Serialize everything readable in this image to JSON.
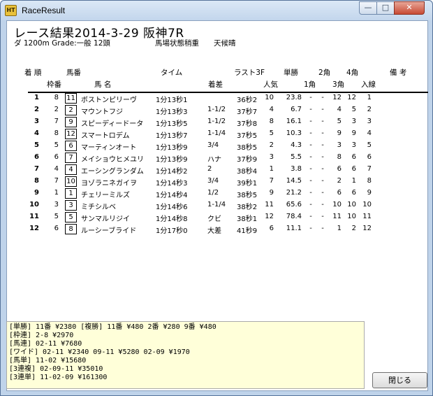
{
  "window": {
    "icon_text": "HT",
    "title": "RaceResult",
    "min_glyph": "—",
    "max_glyph": "□",
    "close_glyph": "✕"
  },
  "race": {
    "title": "レース結果2014-3-29 阪神7R",
    "info": "ダ 1200m Grade:一般 12頭",
    "track": "馬場状態稍重",
    "weather": "天候晴"
  },
  "headers": {
    "row1": {
      "chakujun": "着 順",
      "umaban": "馬番",
      "time": "タイム",
      "last3f": "ラスト3F",
      "tansho": "単勝",
      "kaku2": "2角",
      "kaku4": "4角",
      "biko": "備 考"
    },
    "row2": {
      "wakuban": "枠番",
      "bamei": "馬 名",
      "chakusa": "着差",
      "ninki": "人気",
      "kaku1": "1角",
      "kaku3": "3角",
      "nyusen": "入線"
    }
  },
  "results": [
    {
      "pos": "1",
      "waku": "8",
      "uma": "11",
      "name": "ボストンピリーヴ",
      "time": "1分13秒1",
      "margin": "",
      "last3f": "36秒2",
      "ninki": "10",
      "odds": "23.8",
      "c1": "-",
      "c2": "-",
      "c3": "12",
      "c4": "12",
      "finish": "1"
    },
    {
      "pos": "2",
      "waku": "2",
      "uma": "2",
      "name": "マウントフジ",
      "time": "1分13秒3",
      "margin": "1-1/2",
      "last3f": "37秒7",
      "ninki": "4",
      "odds": "6.7",
      "c1": "-",
      "c2": "-",
      "c3": "4",
      "c4": "5",
      "finish": "2"
    },
    {
      "pos": "3",
      "waku": "7",
      "uma": "9",
      "name": "スピーディードータ",
      "time": "1分13秒5",
      "margin": "1-1/2",
      "last3f": "37秒8",
      "ninki": "8",
      "odds": "16.1",
      "c1": "-",
      "c2": "-",
      "c3": "5",
      "c4": "3",
      "finish": "3"
    },
    {
      "pos": "4",
      "waku": "8",
      "uma": "12",
      "name": "スマートロデム",
      "time": "1分13秒7",
      "margin": "1-1/4",
      "last3f": "37秒5",
      "ninki": "5",
      "odds": "10.3",
      "c1": "-",
      "c2": "-",
      "c3": "9",
      "c4": "9",
      "finish": "4"
    },
    {
      "pos": "5",
      "waku": "5",
      "uma": "6",
      "name": "マーティンオート",
      "time": "1分13秒9",
      "margin": "3/4",
      "last3f": "38秒5",
      "ninki": "2",
      "odds": "4.3",
      "c1": "-",
      "c2": "-",
      "c3": "3",
      "c4": "3",
      "finish": "5"
    },
    {
      "pos": "6",
      "waku": "6",
      "uma": "7",
      "name": "メイショウヒメユリ",
      "time": "1分13秒9",
      "margin": "ハナ",
      "last3f": "37秒9",
      "ninki": "3",
      "odds": "5.5",
      "c1": "-",
      "c2": "-",
      "c3": "8",
      "c4": "6",
      "finish": "6"
    },
    {
      "pos": "7",
      "waku": "4",
      "uma": "4",
      "name": "エーシングランダム",
      "time": "1分14秒2",
      "margin": "2",
      "last3f": "38秒4",
      "ninki": "1",
      "odds": "3.8",
      "c1": "-",
      "c2": "-",
      "c3": "6",
      "c4": "6",
      "finish": "7"
    },
    {
      "pos": "8",
      "waku": "7",
      "uma": "10",
      "name": "ヨゾラニネガイヲ",
      "time": "1分14秒3",
      "margin": "3/4",
      "last3f": "39秒1",
      "ninki": "7",
      "odds": "14.5",
      "c1": "-",
      "c2": "-",
      "c3": "2",
      "c4": "1",
      "finish": "8"
    },
    {
      "pos": "9",
      "waku": "1",
      "uma": "1",
      "name": "チェリーミルズ",
      "time": "1分14秒4",
      "margin": "1/2",
      "last3f": "38秒5",
      "ninki": "9",
      "odds": "21.2",
      "c1": "-",
      "c2": "-",
      "c3": "6",
      "c4": "6",
      "finish": "9"
    },
    {
      "pos": "10",
      "waku": "3",
      "uma": "3",
      "name": "ミチシルベ",
      "time": "1分14秒6",
      "margin": "1-1/4",
      "last3f": "38秒2",
      "ninki": "11",
      "odds": "65.6",
      "c1": "-",
      "c2": "-",
      "c3": "10",
      "c4": "10",
      "finish": "10"
    },
    {
      "pos": "11",
      "waku": "5",
      "uma": "5",
      "name": "サンマルリジイ",
      "time": "1分14秒8",
      "margin": "クビ",
      "last3f": "38秒1",
      "ninki": "12",
      "odds": "78.4",
      "c1": "-",
      "c2": "-",
      "c3": "11",
      "c4": "10",
      "finish": "11"
    },
    {
      "pos": "12",
      "waku": "6",
      "uma": "8",
      "name": "ルーシーブライド",
      "time": "1分17秒0",
      "margin": "大差",
      "last3f": "41秒9",
      "ninki": "6",
      "odds": "11.1",
      "c1": "-",
      "c2": "-",
      "c3": "1",
      "c4": "2",
      "finish": "12"
    }
  ],
  "payouts": [
    "[単勝] 11番 ¥2380    [複勝] 11番 ¥480  2番 ¥280  9番 ¥480",
    "[枠連] 2-8 ¥2970",
    "[馬連] 02-11 ¥7680",
    "[ワイド] 02-11 ¥2340  09-11 ¥5280  02-09 ¥1970",
    "[馬単] 11-02 ¥15680",
    "[3連複] 02-09-11 ¥35010",
    "[3連単] 11-02-09 ¥161300"
  ],
  "close_button_label": "閉じる"
}
